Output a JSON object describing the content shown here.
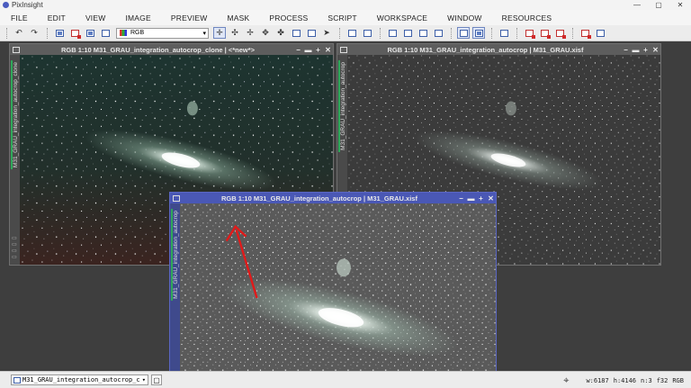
{
  "titlebar": {
    "app_name": "PixInsight",
    "minimize": "—",
    "maximize": "▢",
    "close": "✕"
  },
  "menu": [
    "FILE",
    "EDIT",
    "VIEW",
    "IMAGE",
    "PREVIEW",
    "MASK",
    "PROCESS",
    "SCRIPT",
    "WORKSPACE",
    "WINDOW",
    "RESOURCES"
  ],
  "toolbar": {
    "undo": "↶",
    "redo": "↷",
    "channel_select": "RGB",
    "select_arrow": "▾"
  },
  "windows": {
    "clone": {
      "title": "RGB 1:10 M31_GRAU_integration_autocrop_clone | <*new*>",
      "side_label": "M31_GRAU_integration_autocrop_clone"
    },
    "original": {
      "title": "RGB 1:10 M31_GRAU_integration_autocrop | M31_GRAU.xisf",
      "side_label": "M31_GRAU_integration_autocrop"
    },
    "active": {
      "title": "RGB 1:10 M31_GRAU_integration_autocrop | M31_GRAU.xisf",
      "side_label": "M31_GRAU_integration_autocrop"
    },
    "controls": {
      "shade": "−",
      "minimize": "▬",
      "maximize": "+",
      "close": "✕"
    }
  },
  "statusbar": {
    "view_select": "M31_GRAU_integration_autocrop_c",
    "select_arrow": "▾",
    "width": "w:6187",
    "height": "h:4146",
    "channels": "n:3",
    "sample_format": "f32",
    "color_space": "RGB"
  },
  "colors": {
    "active_window_title": "#4a58b5",
    "annotation_arrow": "#e11a1a"
  }
}
